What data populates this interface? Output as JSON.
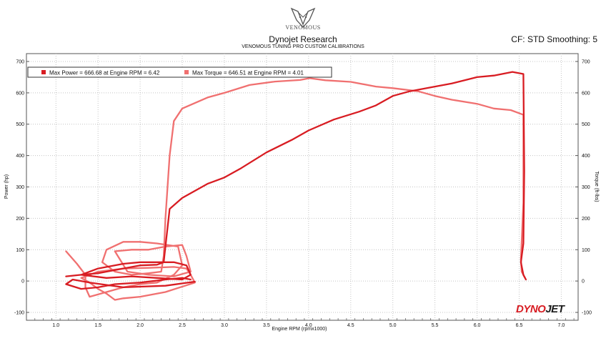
{
  "header": {
    "logo_text": "VENOMOUS",
    "title": "Dynojet Research",
    "subtitle": "VENOMOUS TUNING PRO CUSTOM CALIBRATIONS",
    "settings": "CF: STD Smoothing: 5"
  },
  "brand": {
    "part1": "DYNO",
    "part2": "JET"
  },
  "colors": {
    "power": "#d81c22",
    "torque": "#f07070"
  },
  "chart_data": {
    "type": "line",
    "xlabel": "Engine RPM (rpmx1000)",
    "ylabel_left": "Power (hp)",
    "ylabel_right": "Torque (ft-lbs)",
    "xlim": [
      0.65,
      7.2
    ],
    "ylim": [
      -125,
      725
    ],
    "xticks": [
      1.0,
      1.5,
      2.0,
      2.5,
      3.0,
      3.5,
      4.0,
      4.5,
      5.0,
      5.5,
      6.0,
      6.5,
      7.0
    ],
    "yticks": [
      -100,
      0,
      100,
      200,
      300,
      400,
      500,
      600,
      700
    ],
    "grid": true,
    "legend_position": "top-left",
    "series": [
      {
        "name": "Max Power = 666.68 at Engine RPM = 6.42",
        "color": "#d81c22",
        "points": [
          [
            1.12,
            15
          ],
          [
            1.3,
            20
          ],
          [
            1.5,
            25
          ],
          [
            1.8,
            40
          ],
          [
            2.0,
            50
          ],
          [
            2.2,
            52
          ],
          [
            2.28,
            60
          ],
          [
            2.3,
            110
          ],
          [
            2.35,
            230
          ],
          [
            2.5,
            265
          ],
          [
            2.8,
            310
          ],
          [
            3.0,
            330
          ],
          [
            3.2,
            360
          ],
          [
            3.5,
            410
          ],
          [
            3.8,
            450
          ],
          [
            4.0,
            480
          ],
          [
            4.3,
            515
          ],
          [
            4.6,
            540
          ],
          [
            4.8,
            560
          ],
          [
            5.0,
            590
          ],
          [
            5.2,
            605
          ],
          [
            5.5,
            620
          ],
          [
            5.7,
            630
          ],
          [
            6.0,
            650
          ],
          [
            6.2,
            655
          ],
          [
            6.42,
            666.68
          ],
          [
            6.55,
            660
          ],
          [
            6.56,
            350
          ],
          [
            6.55,
            120
          ],
          [
            6.52,
            60
          ],
          [
            6.55,
            20
          ],
          [
            6.58,
            5
          ],
          null,
          [
            2.6,
            5
          ],
          [
            2.5,
            10
          ],
          [
            2.3,
            5
          ],
          [
            2.0,
            -5
          ],
          [
            1.7,
            -10
          ],
          [
            1.5,
            -20
          ],
          [
            1.3,
            -25
          ],
          [
            1.12,
            -10
          ],
          [
            1.2,
            5
          ],
          [
            1.4,
            -5
          ],
          [
            1.8,
            -20
          ],
          [
            2.3,
            -15
          ],
          [
            2.65,
            -2
          ],
          null,
          [
            1.3,
            20
          ],
          [
            1.5,
            40
          ],
          [
            1.8,
            55
          ],
          [
            2.0,
            60
          ],
          [
            2.2,
            60
          ],
          [
            2.4,
            60
          ],
          [
            2.55,
            50
          ],
          [
            2.6,
            20
          ],
          [
            2.5,
            5
          ],
          [
            2.2,
            10
          ],
          [
            1.9,
            15
          ],
          [
            1.6,
            10
          ],
          [
            1.3,
            20
          ]
        ]
      },
      {
        "name": "Max Torque = 646.51 at Engine RPM = 4.01",
        "color": "#f07070",
        "points": [
          [
            1.12,
            95
          ],
          [
            1.25,
            55
          ],
          [
            1.35,
            20
          ],
          [
            1.35,
            -20
          ],
          [
            1.4,
            -50
          ],
          [
            1.6,
            -35
          ],
          [
            1.8,
            -20
          ],
          [
            2.0,
            -10
          ],
          [
            2.2,
            -5
          ],
          [
            2.4,
            20
          ],
          [
            2.5,
            50
          ],
          [
            2.45,
            110
          ],
          [
            2.2,
            120
          ],
          [
            2.0,
            125
          ],
          [
            1.8,
            125
          ],
          [
            1.6,
            100
          ],
          [
            1.55,
            60
          ],
          [
            1.7,
            30
          ],
          [
            1.9,
            20
          ],
          [
            2.1,
            25
          ],
          [
            2.25,
            30
          ],
          [
            2.28,
            80
          ],
          [
            2.3,
            200
          ],
          [
            2.35,
            400
          ],
          [
            2.4,
            510
          ],
          [
            2.5,
            550
          ],
          [
            2.8,
            585
          ],
          [
            3.0,
            600
          ],
          [
            3.3,
            625
          ],
          [
            3.6,
            636
          ],
          [
            3.9,
            641
          ],
          [
            4.01,
            646.51
          ],
          [
            4.2,
            640
          ],
          [
            4.5,
            635
          ],
          [
            4.8,
            620
          ],
          [
            5.0,
            615
          ],
          [
            5.3,
            605
          ],
          [
            5.5,
            590
          ],
          [
            5.7,
            578
          ],
          [
            6.0,
            565
          ],
          [
            6.2,
            550
          ],
          [
            6.4,
            545
          ],
          [
            6.55,
            530
          ],
          [
            6.55,
            250
          ],
          [
            6.52,
            70
          ],
          [
            6.53,
            30
          ],
          [
            6.57,
            10
          ],
          null,
          [
            2.55,
            40
          ],
          [
            2.6,
            20
          ],
          [
            2.65,
            -5
          ],
          [
            2.3,
            -35
          ],
          [
            2.0,
            -50
          ],
          [
            1.8,
            -55
          ],
          [
            1.7,
            -60
          ],
          [
            1.6,
            -40
          ],
          [
            1.5,
            -25
          ],
          [
            1.4,
            -5
          ],
          [
            1.3,
            10
          ],
          [
            1.5,
            30
          ],
          [
            1.8,
            40
          ],
          [
            2.1,
            42
          ],
          [
            2.4,
            45
          ],
          [
            2.55,
            40
          ],
          null,
          [
            1.7,
            95
          ],
          [
            1.9,
            100
          ],
          [
            2.1,
            100
          ],
          [
            2.3,
            110
          ],
          [
            2.5,
            115
          ],
          [
            2.55,
            80
          ],
          [
            2.6,
            30
          ],
          [
            2.4,
            15
          ],
          [
            2.1,
            20
          ],
          [
            1.85,
            30
          ],
          [
            1.7,
            95
          ]
        ]
      }
    ]
  }
}
